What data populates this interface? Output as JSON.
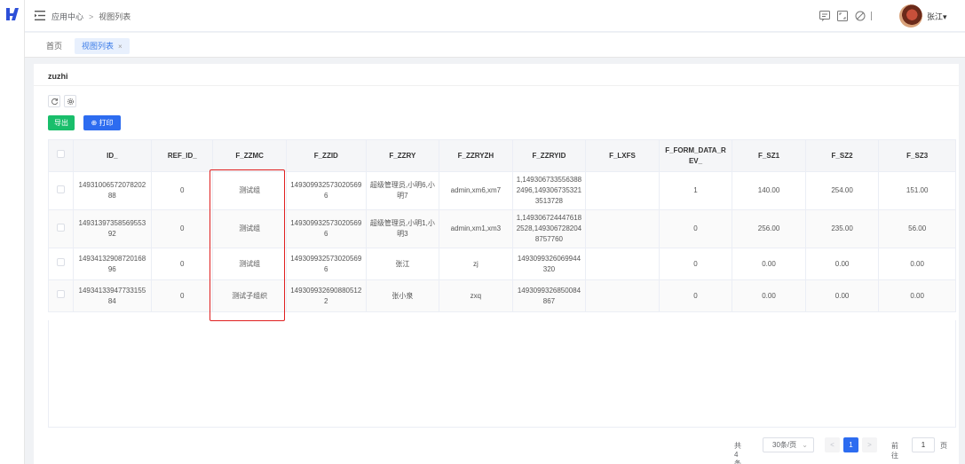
{
  "breadcrumb": {
    "root": "应用中心",
    "separator": ">",
    "current": "视图列表"
  },
  "user": {
    "name": "张江",
    "caret": "▾"
  },
  "tabs": [
    {
      "label": "首页"
    },
    {
      "label": "视图列表",
      "close": "×"
    }
  ],
  "panel": {
    "title": "zuzhi"
  },
  "toolbar": {
    "export_label": "导出",
    "print_label": "⊕ 打印"
  },
  "table": {
    "headers": [
      "ID_",
      "REF_ID_",
      "F_ZZMC",
      "F_ZZID",
      "F_ZZRY",
      "F_ZZRYZH",
      "F_ZZRYID",
      "F_LXFS",
      "F_FORM_DATA_REV_",
      "F_SZ1",
      "F_SZ2",
      "F_SZ3"
    ],
    "rows": [
      [
        "1493100657207820288",
        "0",
        "测试组",
        "1493099325730205696",
        "超级管理员,小明6,小明7",
        "admin,xm6,xm7",
        "1,1493067335563882496,1493067353213513728",
        "",
        "1",
        "140.00",
        "254.00",
        "151.00"
      ],
      [
        "1493139735856955392",
        "0",
        "测试组",
        "1493099325730205696",
        "超级管理员,小明1,小明3",
        "admin,xm1,xm3",
        "1,1493067244476182528,1493067282048757760",
        "",
        "0",
        "256.00",
        "235.00",
        "56.00"
      ],
      [
        "1493413290872016896",
        "0",
        "测试组",
        "1493099325730205696",
        "张江",
        "zj",
        "1493099326069944320",
        "",
        "0",
        "0.00",
        "0.00",
        "0.00"
      ],
      [
        "1493413394773315584",
        "0",
        "测试子组织",
        "1493099326908805122",
        "张小泉",
        "zxq",
        "1493099326850084867",
        "",
        "0",
        "0.00",
        "0.00",
        "0.00"
      ]
    ]
  },
  "pagination": {
    "total": "共 4 条",
    "page_size": "30条/页",
    "prev": "<",
    "current_page": "1",
    "next": ">",
    "goto_label": "前往",
    "goto_value": "1",
    "goto_unit": "页"
  },
  "colors": {
    "primary": "#2d6cf0",
    "success": "#19be6b",
    "highlight": "#e02020"
  }
}
